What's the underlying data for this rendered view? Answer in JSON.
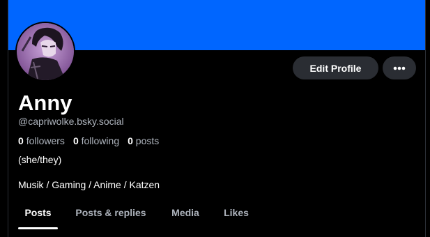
{
  "profile": {
    "name": "Anny",
    "handle": "@capriwolke.bsky.social",
    "pronouns": "(she/they)",
    "bio": "Musik / Gaming / Anime / Katzen",
    "banner_color": "#0066ff"
  },
  "stats": {
    "followers_count": "0",
    "followers_label": "followers",
    "following_count": "0",
    "following_label": "following",
    "posts_count": "0",
    "posts_label": "posts"
  },
  "actions": {
    "edit_profile_label": "Edit Profile",
    "more_icon": "ellipsis-icon"
  },
  "tabs": [
    {
      "label": "Posts",
      "active": true
    },
    {
      "label": "Posts & replies",
      "active": false
    },
    {
      "label": "Media",
      "active": false
    },
    {
      "label": "Likes",
      "active": false
    }
  ]
}
